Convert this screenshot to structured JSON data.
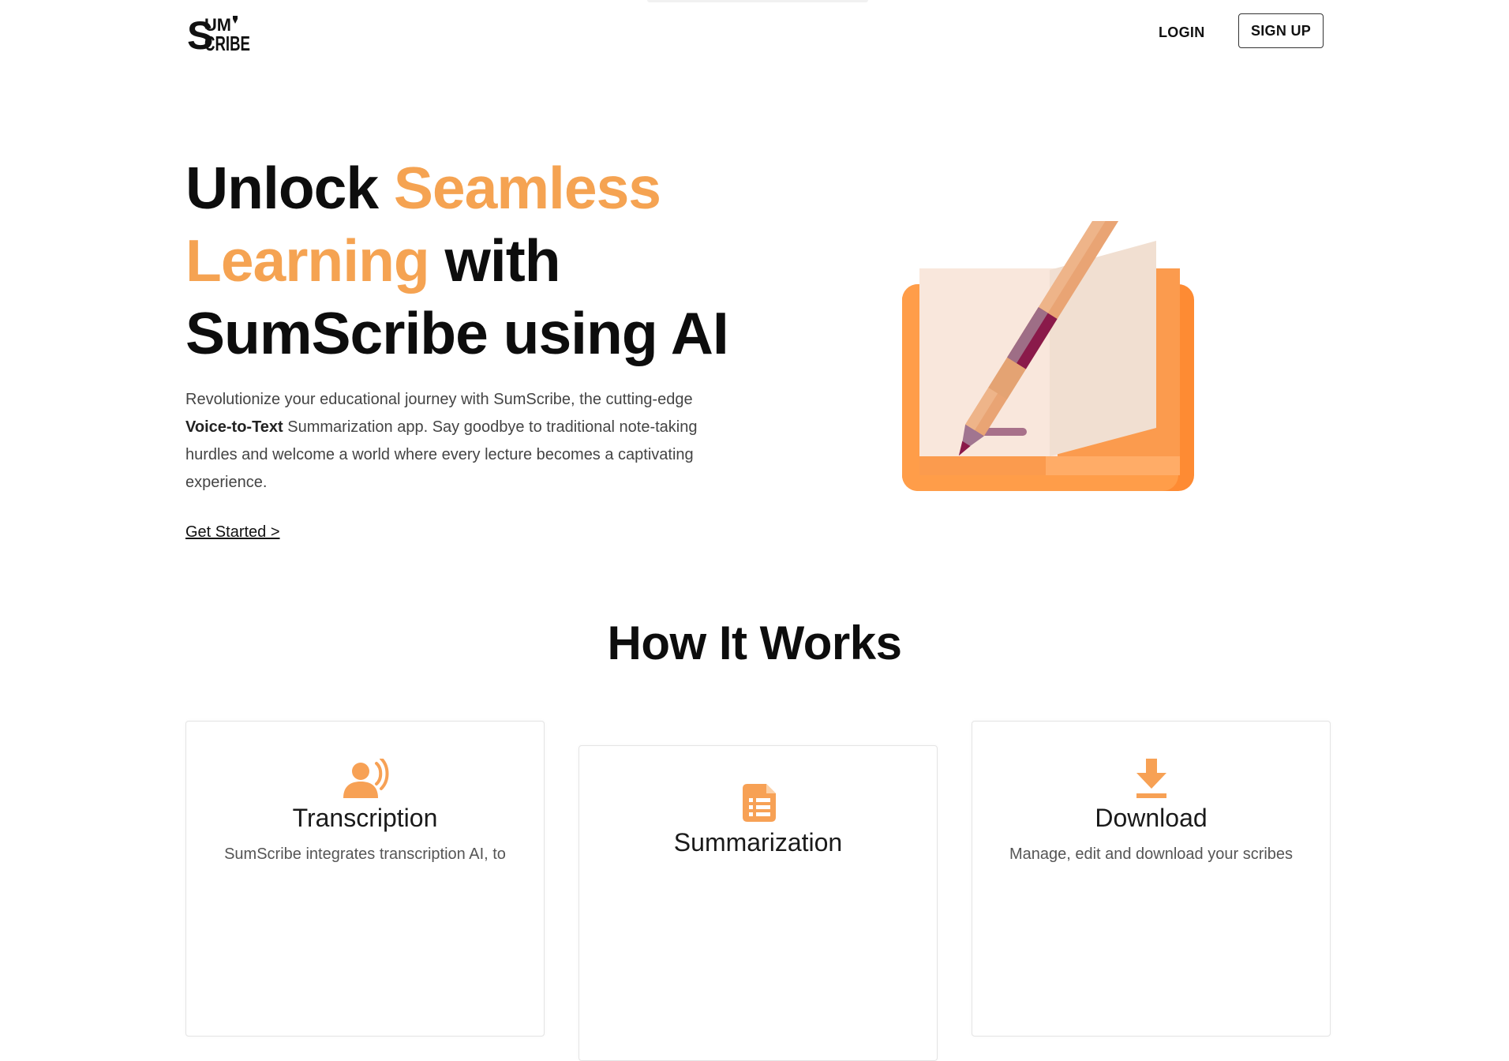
{
  "brand": {
    "logo_text_top": "SUM",
    "logo_text_bottom": "SCRIBE"
  },
  "nav": {
    "login": "LOGIN",
    "signup": "SIGN UP"
  },
  "hero": {
    "title_part1": "Unlock ",
    "title_accent": "Seamless Learning",
    "title_part2": " with SumScribe using AI",
    "desc_part1": "Revolutionize your educational journey with SumScribe, the cutting-edge ",
    "desc_bold": "Voice-to-Text",
    "desc_part2": " Summarization app. Say goodbye to traditional note-taking hurdles and welcome a world where every lecture becomes a captivating experience.",
    "cta": "Get Started >"
  },
  "how_it_works": {
    "title": "How It Works",
    "cards": [
      {
        "icon": "voice-user-icon",
        "title": "Transcription",
        "text": "SumScribe integrates transcription AI, to"
      },
      {
        "icon": "document-icon",
        "title": "Summarization",
        "text": ""
      },
      {
        "icon": "download-icon",
        "title": "Download",
        "text": "Manage, edit and download your scribes"
      }
    ]
  },
  "colors": {
    "accent": "#f5a352",
    "icon_orange": "#f7a155",
    "text_dark": "#0d0d0d"
  }
}
